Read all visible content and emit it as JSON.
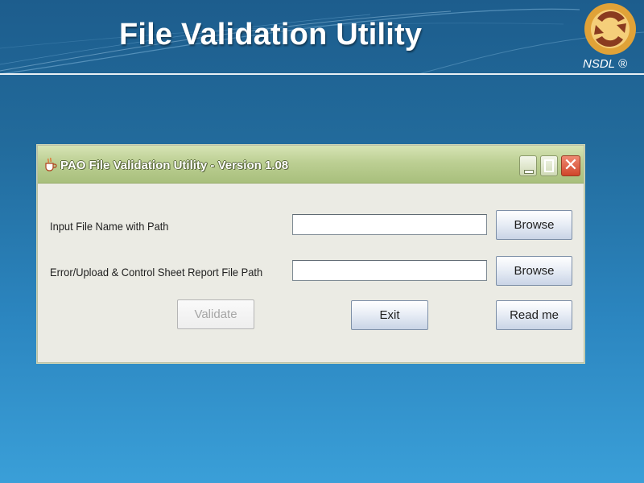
{
  "slide": {
    "title": "File Validation Utility",
    "logo_text": "NSDL ®"
  },
  "window": {
    "title": "PAO File Validation Utility - Version 1.08",
    "controls": {
      "minimize_icon": "minimize-icon",
      "maximize_icon": "maximize-icon",
      "close_glyph": "✕"
    }
  },
  "form": {
    "input_file_label": "Input File Name with Path",
    "input_file_value": "",
    "report_path_label": "Error/Upload & Control Sheet Report File Path",
    "report_path_value": "",
    "browse_label_1": "Browse",
    "browse_label_2": "Browse",
    "validate_label": "Validate",
    "validate_enabled": false,
    "exit_label": "Exit",
    "readme_label": "Read me"
  },
  "colors": {
    "background_top": "#1d5d8d",
    "background_bottom": "#3a9fd8",
    "titlebar": "#bccf93",
    "close_button": "#d0462a",
    "logo_gold": "#e0a238",
    "logo_brown": "#8a3b1f"
  }
}
